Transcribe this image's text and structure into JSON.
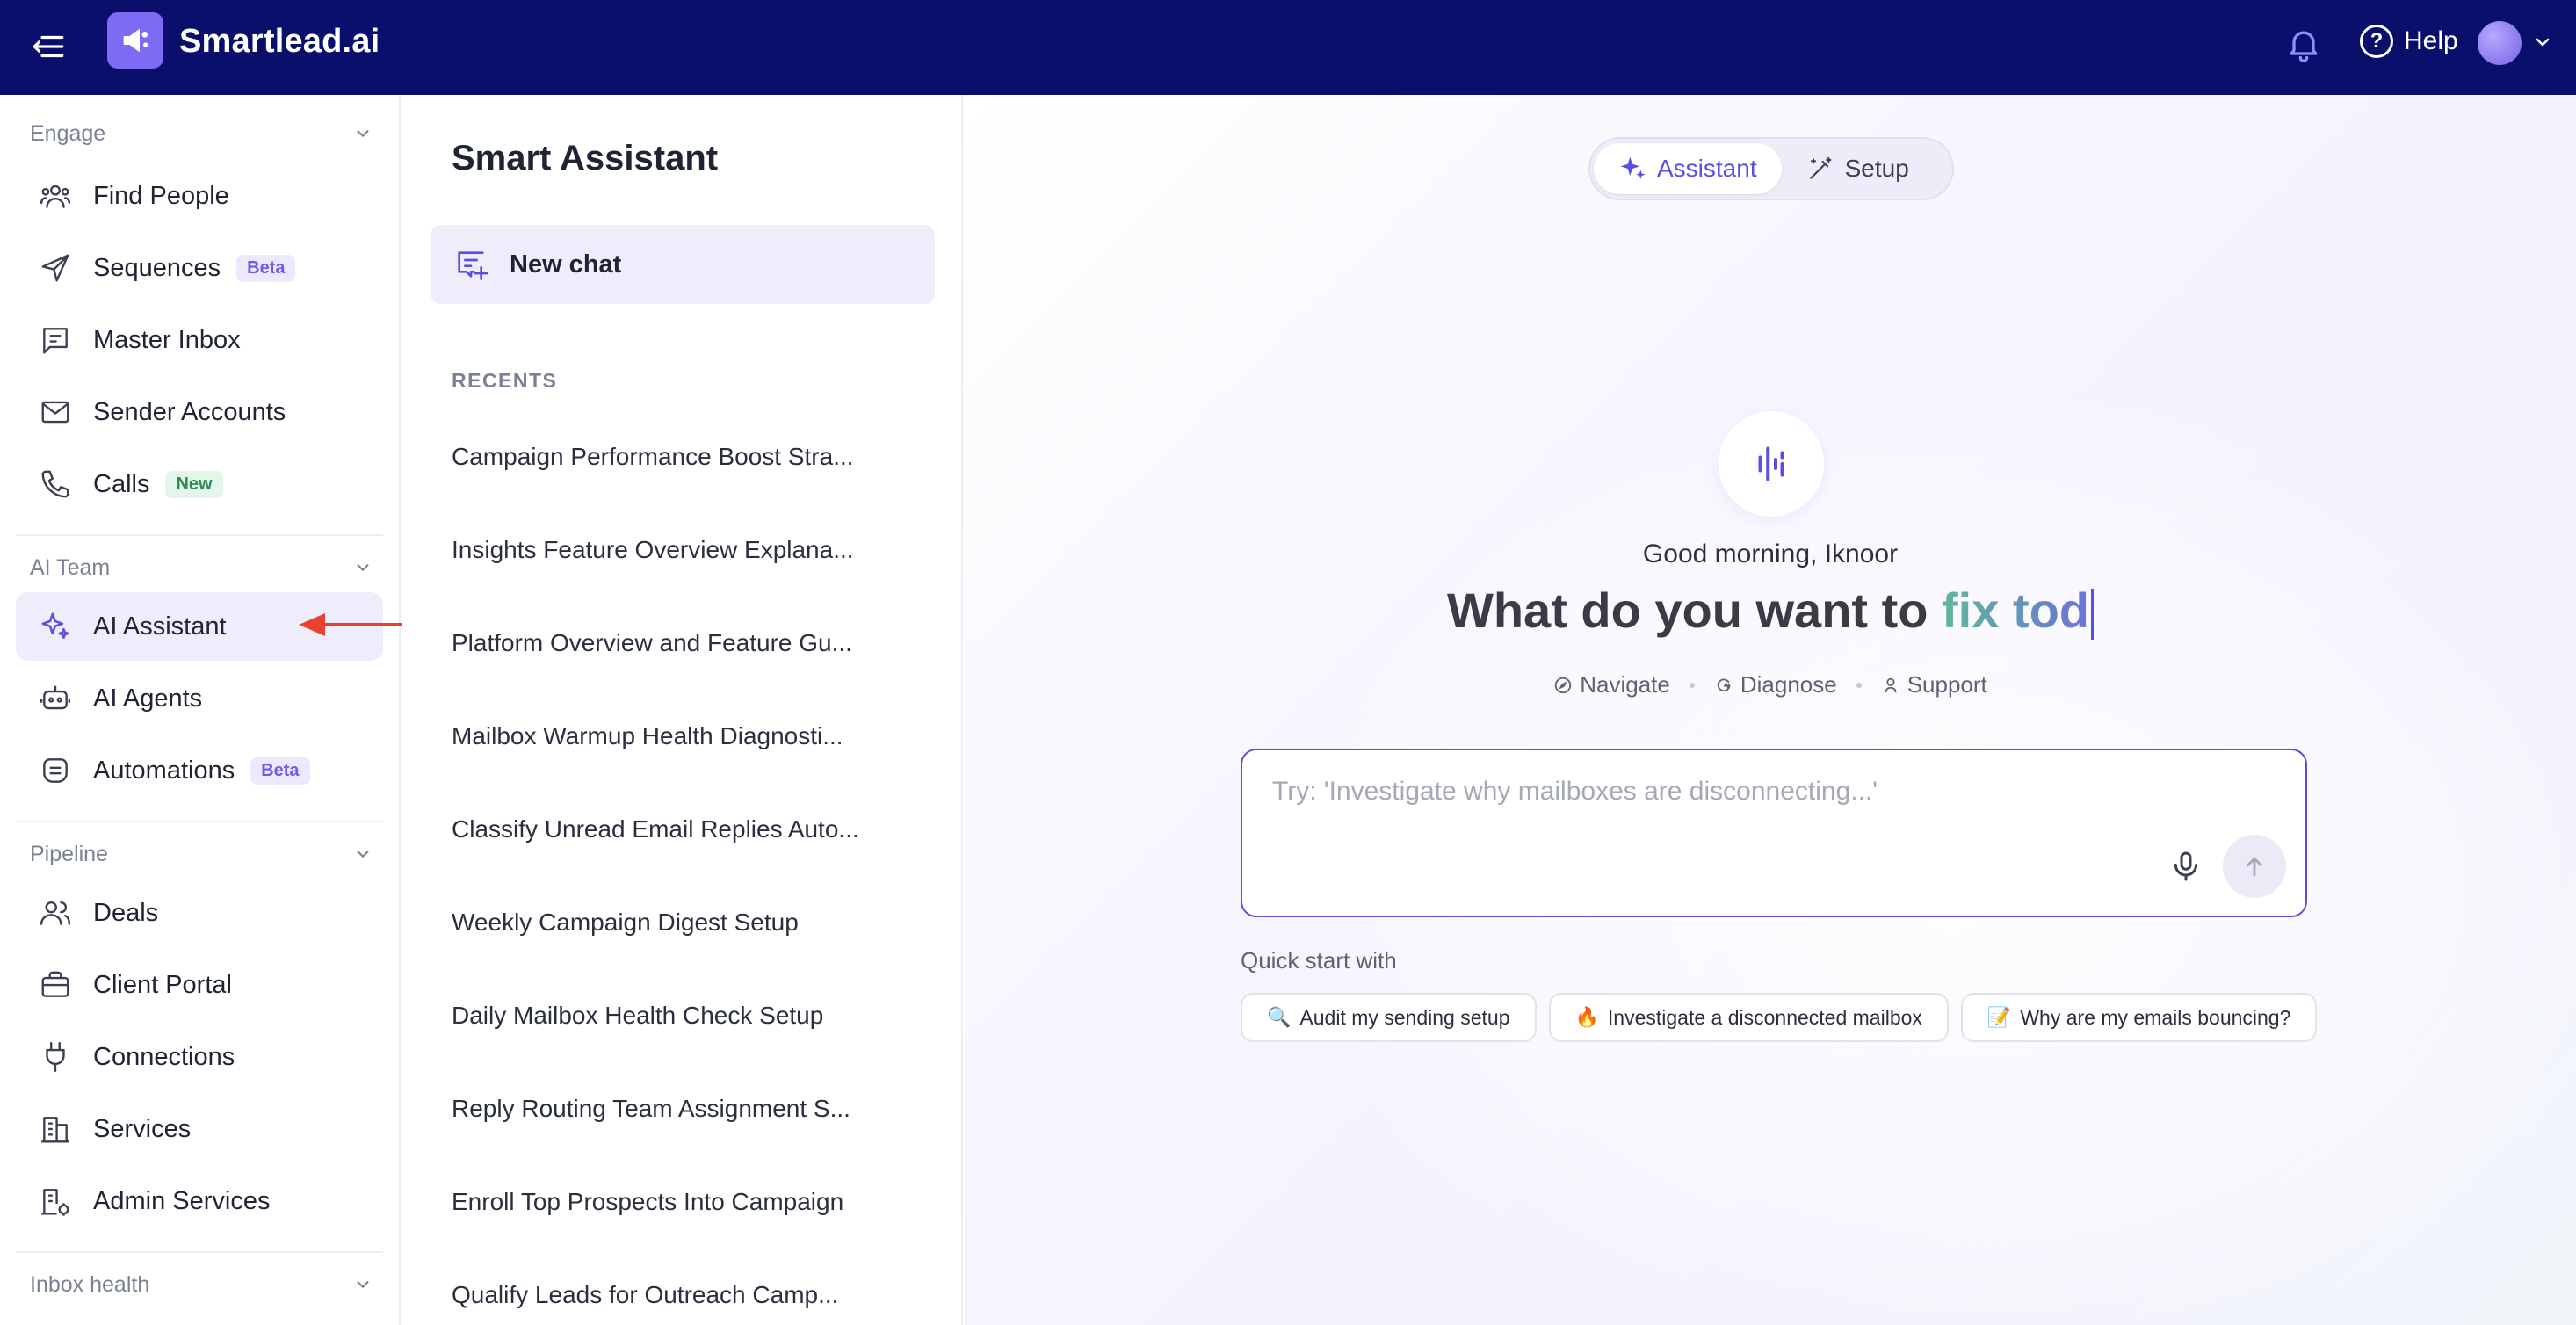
{
  "app": {
    "name": "Smartlead.ai"
  },
  "topbar": {
    "help_label": "Help"
  },
  "sidebar": {
    "sections": [
      {
        "title": "Engage"
      },
      {
        "title": "AI Team"
      },
      {
        "title": "Pipeline"
      },
      {
        "title": "Inbox health"
      }
    ],
    "items": [
      {
        "label": "Find People"
      },
      {
        "label": "Sequences",
        "badge": "Beta"
      },
      {
        "label": "Master Inbox"
      },
      {
        "label": "Sender Accounts"
      },
      {
        "label": "Calls",
        "badge": "New"
      },
      {
        "label": "AI Assistant"
      },
      {
        "label": "AI Agents"
      },
      {
        "label": "Automations",
        "badge": "Beta"
      },
      {
        "label": "Deals"
      },
      {
        "label": "Client Portal"
      },
      {
        "label": "Connections"
      },
      {
        "label": "Services"
      },
      {
        "label": "Admin Services"
      }
    ]
  },
  "assistant_panel": {
    "title": "Smart Assistant",
    "new_chat_label": "New chat",
    "recents_label": "RECENTS",
    "recents": [
      "Campaign Performance Boost Stra...",
      "Insights Feature Overview Explana...",
      "Platform Overview and Feature Gu...",
      "Mailbox Warmup Health Diagnosti...",
      "Classify Unread Email Replies Auto...",
      "Weekly Campaign Digest Setup",
      "Daily Mailbox Health Check Setup",
      "Reply Routing Team Assignment S...",
      "Enroll Top Prospects Into Campaign",
      "Qualify Leads for Outreach Camp..."
    ]
  },
  "main": {
    "tabs": [
      {
        "label": "Assistant"
      },
      {
        "label": "Setup"
      }
    ],
    "greeting": "Good morning, Iknoor",
    "headline_prefix": "What do you want to ",
    "headline_highlight": "fix tod",
    "modes": [
      "Navigate",
      "Diagnose",
      "Support"
    ],
    "input_placeholder": "Try: 'Investigate why mailboxes are disconnecting...'",
    "quick_start_label": "Quick start with",
    "quick_starts": [
      {
        "emoji": "🔍",
        "label": "Audit my sending setup"
      },
      {
        "emoji": "🔥",
        "label": "Investigate a disconnected mailbox"
      },
      {
        "emoji": "📝",
        "label": "Why are my emails bouncing?"
      }
    ]
  },
  "colors": {
    "topbar_bg": "#0a0f6b",
    "accent": "#5a4fe0",
    "active_bg": "#efedfc",
    "annotation_arrow": "#e8412c"
  }
}
